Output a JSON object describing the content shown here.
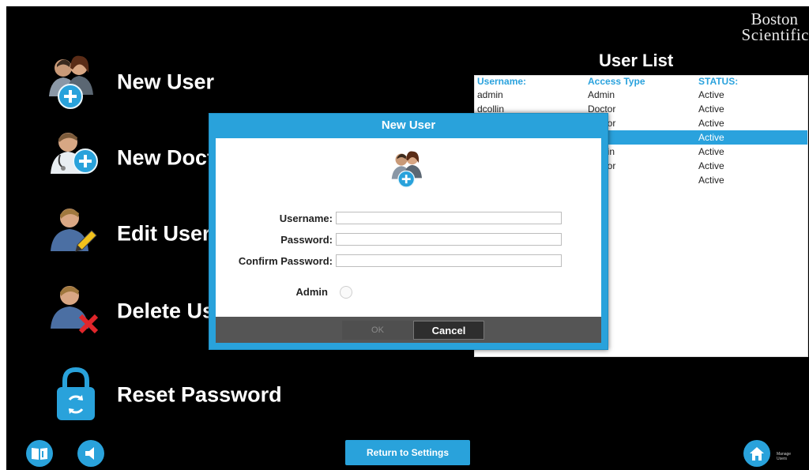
{
  "logo": {
    "line1": "Boston",
    "line2": "Scientific"
  },
  "menu": {
    "new_user": "New User",
    "new_doctor": "New Doctor",
    "edit_user": "Edit User",
    "delete_user": "Delete User",
    "reset_password": "Reset Password"
  },
  "user_list": {
    "title": "User List",
    "columns": [
      "Username:",
      "Access Type",
      "STATUS:"
    ],
    "rows": [
      [
        "admin",
        "Admin",
        "Active"
      ],
      [
        "dcollin",
        "Doctor",
        "Active"
      ],
      [
        "",
        "Doctor",
        "Active"
      ],
      [
        "",
        "",
        "Active"
      ],
      [
        "",
        "Admin",
        "Active"
      ],
      [
        "",
        "Doctor",
        "Active"
      ],
      [
        "",
        "",
        "Active"
      ]
    ],
    "selected_row": 3
  },
  "dialog": {
    "title": "New User",
    "username_label": "Username:",
    "password_label": "Password:",
    "confirm_label": "Confirm Password:",
    "admin_label": "Admin",
    "username_value": "",
    "password_value": "",
    "confirm_value": "",
    "ok_label": "OK",
    "cancel_label": "Cancel"
  },
  "bottom": {
    "return_label": "Return to Settings",
    "manage_label": "Manage Users"
  },
  "colors": {
    "accent": "#29a2db",
    "background": "#000000"
  }
}
